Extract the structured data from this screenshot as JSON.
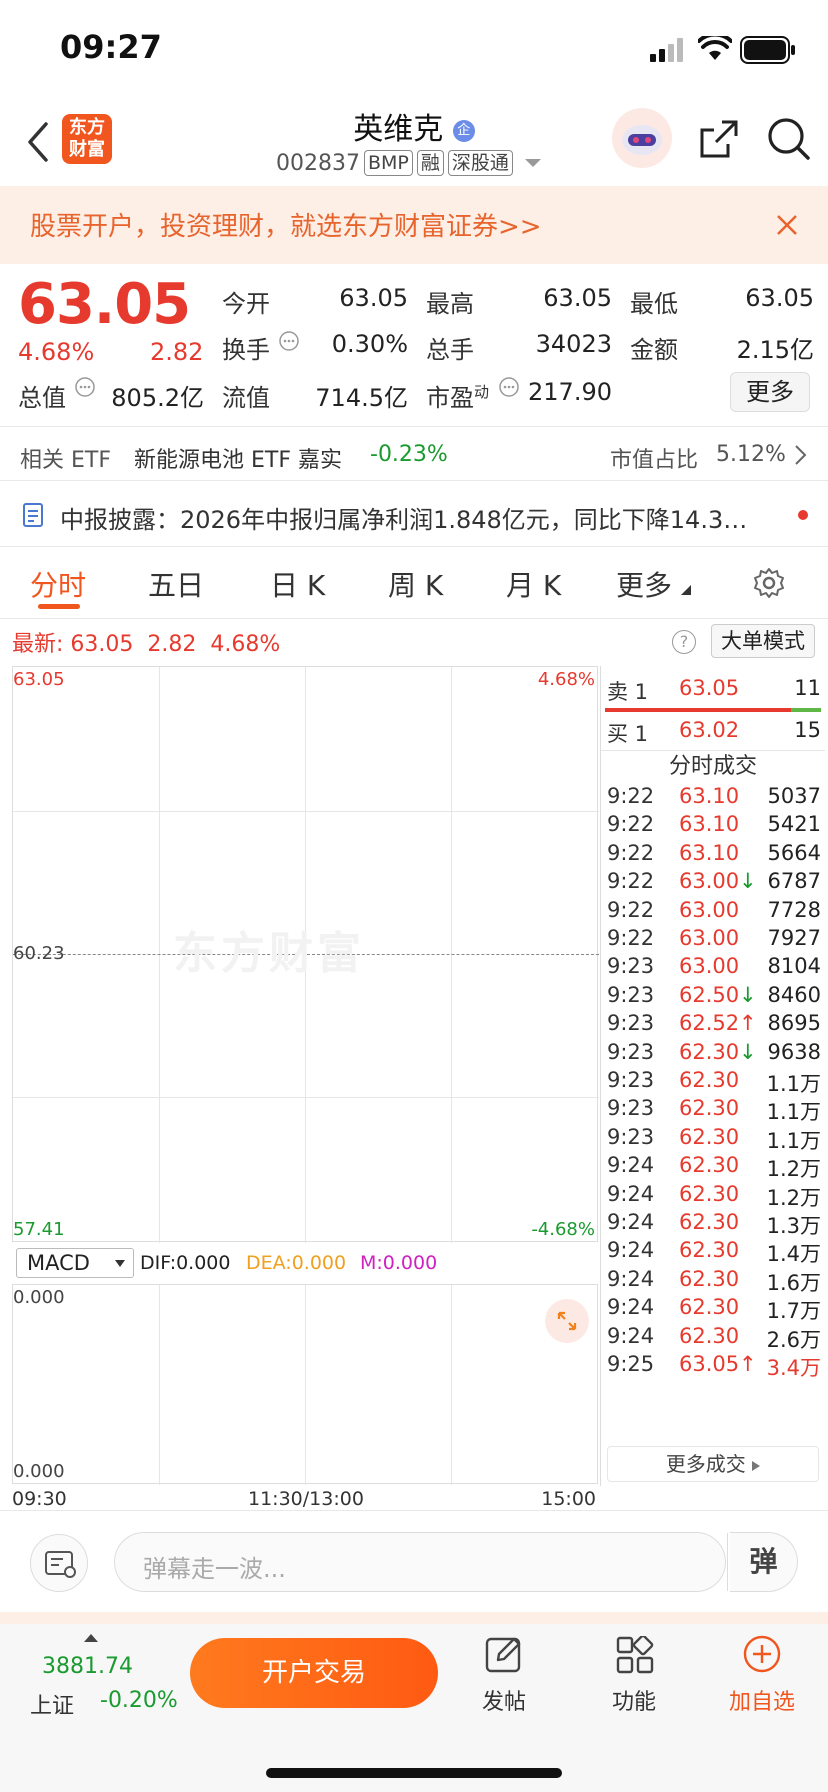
{
  "status": {
    "time": "09:27"
  },
  "nav": {
    "app_logo_line1": "东方",
    "app_logo_line2": "财富",
    "stock_name": "英维克",
    "stock_name_badge": "企",
    "code": "002837",
    "tags": [
      "BMP",
      "融",
      "深股通"
    ]
  },
  "banner": {
    "text": "股票开户，投资理财，就选东方财富证券>>"
  },
  "quote": {
    "price": "63.05",
    "change_pct": "4.68%",
    "change": "2.82",
    "fields": [
      {
        "label": "今开",
        "value": "63.05",
        "color": "red"
      },
      {
        "label": "最高",
        "value": "63.05",
        "color": "red"
      },
      {
        "label": "最低",
        "value": "63.05",
        "color": "red"
      },
      {
        "label": "换手",
        "value": "0.30%",
        "color": "black"
      },
      {
        "label": "总手",
        "value": "34023",
        "color": "black"
      },
      {
        "label": "金额",
        "value": "2.15亿",
        "color": "black"
      },
      {
        "label": "总值",
        "value": "805.2亿",
        "color": "black"
      },
      {
        "label": "流值",
        "value": "714.5亿",
        "color": "black"
      },
      {
        "label": "市盈",
        "label_sup": "动",
        "value": "217.90",
        "color": "black"
      }
    ],
    "more_label": "更多"
  },
  "etf": {
    "label": "相关 ETF",
    "name": "新能源电池 ETF 嘉实",
    "change": "-0.23%",
    "ratio_label": "市值占比",
    "ratio": "5.12%"
  },
  "notice": {
    "text": "中报披露：2026年中报归属净利润1.848亿元，同比下降14.3…"
  },
  "tabs": [
    {
      "label": "分时",
      "active": true
    },
    {
      "label": "五日"
    },
    {
      "label": "日 K"
    },
    {
      "label": "周 K"
    },
    {
      "label": "月 K"
    },
    {
      "label": "更多"
    }
  ],
  "latest": {
    "label": "最新:",
    "price": "63.05",
    "change": "2.82",
    "pct": "4.68%",
    "help": "?",
    "big_order_label": "大单模式"
  },
  "chart": {
    "y_top": "63.05",
    "y_mid": "60.23",
    "y_bottom": "57.41",
    "pct_top": "4.68%",
    "pct_bottom": "-4.68%",
    "watermark": "东方财富",
    "x_labels": [
      "09:30",
      "11:30/13:00",
      "15:00"
    ]
  },
  "macd": {
    "select": "MACD",
    "dif": "DIF:0.000",
    "dea": "DEA:0.000",
    "m": "M:0.000",
    "top": "0.000",
    "bottom": "0.000"
  },
  "orderbook": {
    "sell": {
      "label": "卖 1",
      "price": "63.05",
      "vol": "11"
    },
    "buy": {
      "label": "买 1",
      "price": "63.02",
      "vol": "15"
    }
  },
  "trades": {
    "title": "分时成交",
    "rows": [
      {
        "time": "9:22",
        "price": "63.10",
        "vol": "5037",
        "arrow": ""
      },
      {
        "time": "9:22",
        "price": "63.10",
        "vol": "5421",
        "arrow": ""
      },
      {
        "time": "9:22",
        "price": "63.10",
        "vol": "5664",
        "arrow": ""
      },
      {
        "time": "9:22",
        "price": "63.00",
        "vol": "6787",
        "arrow": "↓"
      },
      {
        "time": "9:22",
        "price": "63.00",
        "vol": "7728",
        "arrow": ""
      },
      {
        "time": "9:22",
        "price": "63.00",
        "vol": "7927",
        "arrow": ""
      },
      {
        "time": "9:23",
        "price": "63.00",
        "vol": "8104",
        "arrow": ""
      },
      {
        "time": "9:23",
        "price": "62.50",
        "vol": "8460",
        "arrow": "↓"
      },
      {
        "time": "9:23",
        "price": "62.52",
        "vol": "8695",
        "arrow": "↑"
      },
      {
        "time": "9:23",
        "price": "62.30",
        "vol": "9638",
        "arrow": "↓"
      },
      {
        "time": "9:23",
        "price": "62.30",
        "vol": "1.1万",
        "arrow": ""
      },
      {
        "time": "9:23",
        "price": "62.30",
        "vol": "1.1万",
        "arrow": ""
      },
      {
        "time": "9:23",
        "price": "62.30",
        "vol": "1.1万",
        "arrow": ""
      },
      {
        "time": "9:24",
        "price": "62.30",
        "vol": "1.2万",
        "arrow": ""
      },
      {
        "time": "9:24",
        "price": "62.30",
        "vol": "1.2万",
        "arrow": ""
      },
      {
        "time": "9:24",
        "price": "62.30",
        "vol": "1.3万",
        "arrow": ""
      },
      {
        "time": "9:24",
        "price": "62.30",
        "vol": "1.4万",
        "arrow": ""
      },
      {
        "time": "9:24",
        "price": "62.30",
        "vol": "1.6万",
        "arrow": ""
      },
      {
        "time": "9:24",
        "price": "62.30",
        "vol": "1.7万",
        "arrow": ""
      },
      {
        "time": "9:24",
        "price": "62.30",
        "vol": "2.6万",
        "arrow": ""
      },
      {
        "time": "9:25",
        "price": "63.05",
        "vol": "3.4万",
        "arrow": "↑"
      }
    ],
    "more_label": "更多成交"
  },
  "danmaku": {
    "placeholder": "弹幕走一波...",
    "button": "弹"
  },
  "bottom": {
    "index_value": "3881.74",
    "index_name": "上证",
    "index_change": "-0.20%",
    "open_btn": "开户交易",
    "post": "发帖",
    "functions": "功能",
    "add_watch": "加自选"
  },
  "colors": {
    "red": "#e63a2e",
    "green": "#1a9a2f",
    "orange": "#ff6a1a"
  }
}
